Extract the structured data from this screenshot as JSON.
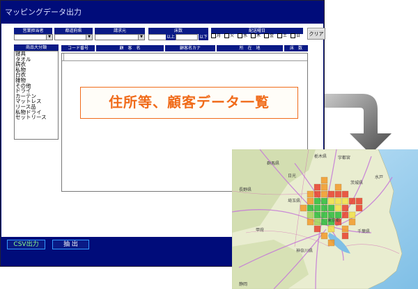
{
  "window": {
    "title": "マッピングデータ出力"
  },
  "filters": {
    "sales_staff": "営業担当者",
    "prefecture": "都道府県",
    "billing": "請求元",
    "tsubo": "床数",
    "tsubo_from": "以上",
    "tsubo_to": "以下",
    "delivery_day": "配送曜日",
    "days": [
      "月",
      "火",
      "水",
      "木",
      "金",
      "土",
      "日"
    ]
  },
  "buttons": {
    "clear": "クリア",
    "csv": "CSV出力",
    "extract": "抽 出"
  },
  "category": {
    "header": "商品大分類",
    "items": [
      "寝具",
      "タオル",
      "病衣",
      "私物",
      "白衣",
      "雑物",
      "その他",
      "ドライ",
      "カーテン",
      "マットレス",
      "リース品",
      "私物ドライ",
      "セットリース"
    ]
  },
  "table": {
    "columns": [
      "コード番号",
      "顧　客　名",
      "顧客名カナ",
      "所　在　地",
      "床　数"
    ]
  },
  "callout": {
    "text": "住所等、顧客データ一覧"
  },
  "map": {
    "labels": [
      "群馬県",
      "栃木県",
      "宇都宮",
      "茨城県",
      "水戸",
      "埼玉県",
      "東京都",
      "千葉県",
      "甲府",
      "神奈川県",
      "静岡",
      "長野県",
      "日光"
    ],
    "cell_colors": [
      "#2dbd3a",
      "#f2e14a",
      "#e8402d",
      "#f39a2a",
      "#a3d45a"
    ]
  }
}
